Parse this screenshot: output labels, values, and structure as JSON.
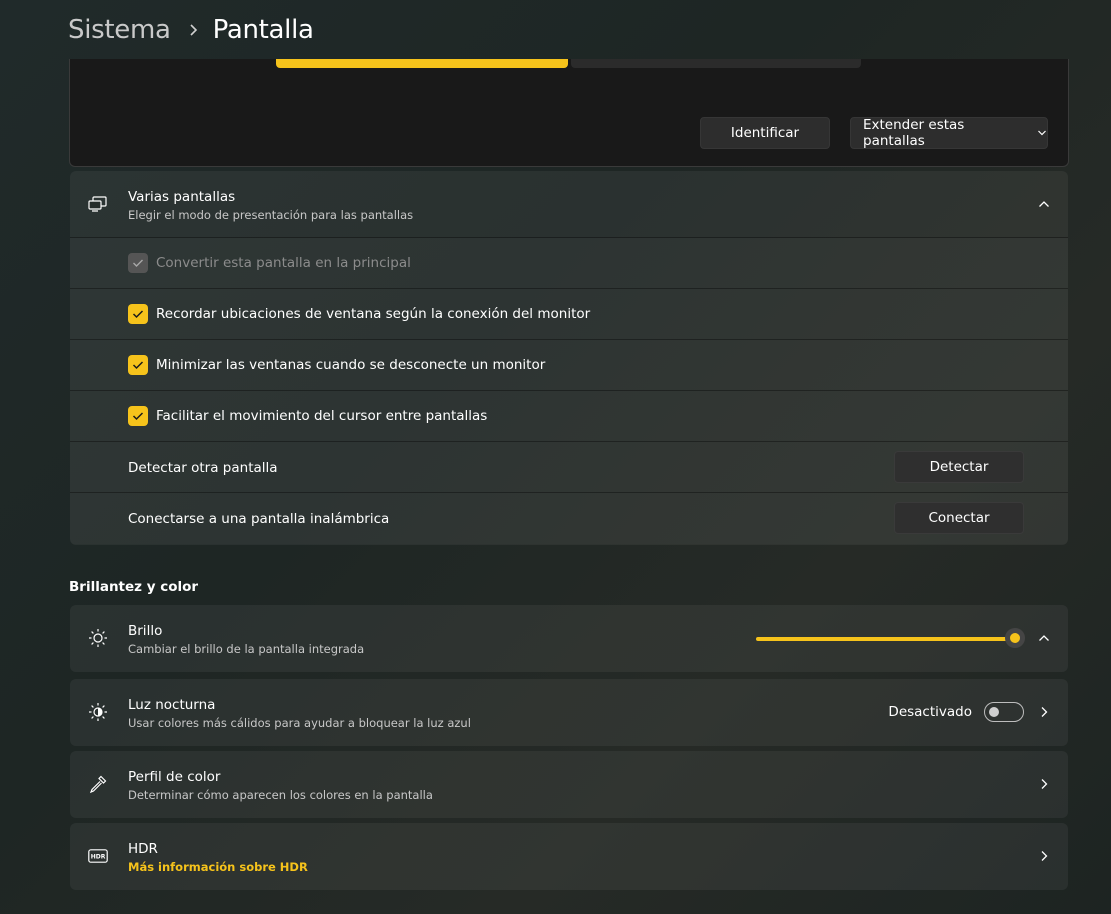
{
  "breadcrumb": {
    "parent": "Sistema",
    "current": "Pantalla"
  },
  "arrangement": {
    "identify_label": "Identificar",
    "mode_label": "Extender estas pantallas"
  },
  "multiple_displays": {
    "title": "Varias pantallas",
    "subtitle": "Elegir el modo de presentación para las pantallas",
    "options": [
      {
        "label": "Convertir esta pantalla en la principal",
        "checked": true,
        "disabled": true
      },
      {
        "label": "Recordar ubicaciones de ventana según la conexión del monitor",
        "checked": true,
        "disabled": false
      },
      {
        "label": "Minimizar las ventanas cuando se desconecte un monitor",
        "checked": true,
        "disabled": false
      },
      {
        "label": "Facilitar el movimiento del cursor entre pantallas",
        "checked": true,
        "disabled": false
      }
    ],
    "detect": {
      "label": "Detectar otra pantalla",
      "button": "Detectar"
    },
    "connect": {
      "label": "Conectarse a una pantalla inalámbrica",
      "button": "Conectar"
    }
  },
  "brightness_section": {
    "title": "Brillantez y color",
    "brightness": {
      "title": "Brillo",
      "subtitle": "Cambiar el brillo de la pantalla integrada",
      "value_percent": 100
    },
    "night_light": {
      "title": "Luz nocturna",
      "subtitle": "Usar colores más cálidos para ayudar a bloquear la luz azul",
      "state_label": "Desactivado",
      "on": false
    },
    "color_profile": {
      "title": "Perfil de color",
      "subtitle": "Determinar cómo aparecen los colores en la pantalla"
    },
    "hdr": {
      "title": "HDR",
      "link": "Más información sobre HDR"
    }
  },
  "colors": {
    "accent": "#f6c31b",
    "background": "#202a2a",
    "card": "#2a302e"
  }
}
